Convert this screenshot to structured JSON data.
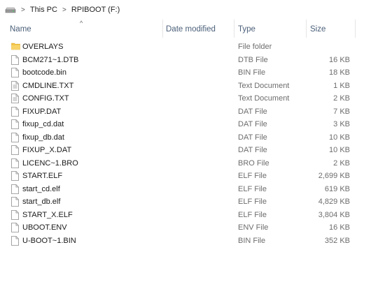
{
  "breadcrumb": {
    "drive_icon": "drive-icon",
    "segments": [
      "This PC",
      "RPIBOOT (F:)"
    ]
  },
  "columns": {
    "name": "Name",
    "date_modified": "Date modified",
    "type": "Type",
    "size": "Size"
  },
  "files": [
    {
      "name": "OVERLAYS",
      "type": "File folder",
      "size": "",
      "icon": "folder-icon"
    },
    {
      "name": "BCM271~1.DTB",
      "type": "DTB File",
      "size": "16 KB",
      "icon": "file-icon"
    },
    {
      "name": "bootcode.bin",
      "type": "BIN File",
      "size": "18 KB",
      "icon": "file-icon"
    },
    {
      "name": "CMDLINE.TXT",
      "type": "Text Document",
      "size": "1 KB",
      "icon": "text-file-icon"
    },
    {
      "name": "CONFIG.TXT",
      "type": "Text Document",
      "size": "2 KB",
      "icon": "text-file-icon"
    },
    {
      "name": "FIXUP.DAT",
      "type": "DAT File",
      "size": "7 KB",
      "icon": "file-icon"
    },
    {
      "name": "fixup_cd.dat",
      "type": "DAT File",
      "size": "3 KB",
      "icon": "file-icon"
    },
    {
      "name": "fixup_db.dat",
      "type": "DAT File",
      "size": "10 KB",
      "icon": "file-icon"
    },
    {
      "name": "FIXUP_X.DAT",
      "type": "DAT File",
      "size": "10 KB",
      "icon": "file-icon"
    },
    {
      "name": "LICENC~1.BRO",
      "type": "BRO File",
      "size": "2 KB",
      "icon": "file-icon"
    },
    {
      "name": "START.ELF",
      "type": "ELF File",
      "size": "2,699 KB",
      "icon": "file-icon"
    },
    {
      "name": "start_cd.elf",
      "type": "ELF File",
      "size": "619 KB",
      "icon": "file-icon"
    },
    {
      "name": "start_db.elf",
      "type": "ELF File",
      "size": "4,829 KB",
      "icon": "file-icon"
    },
    {
      "name": "START_X.ELF",
      "type": "ELF File",
      "size": "3,804 KB",
      "icon": "file-icon"
    },
    {
      "name": "UBOOT.ENV",
      "type": "ENV File",
      "size": "16 KB",
      "icon": "file-icon"
    },
    {
      "name": "U-BOOT~1.BIN",
      "type": "BIN File",
      "size": "352 KB",
      "icon": "file-icon"
    }
  ],
  "colors": {
    "header_text": "#4c607a",
    "secondary_text": "#6d6d6d",
    "folder_yellow": "#f3c443"
  }
}
